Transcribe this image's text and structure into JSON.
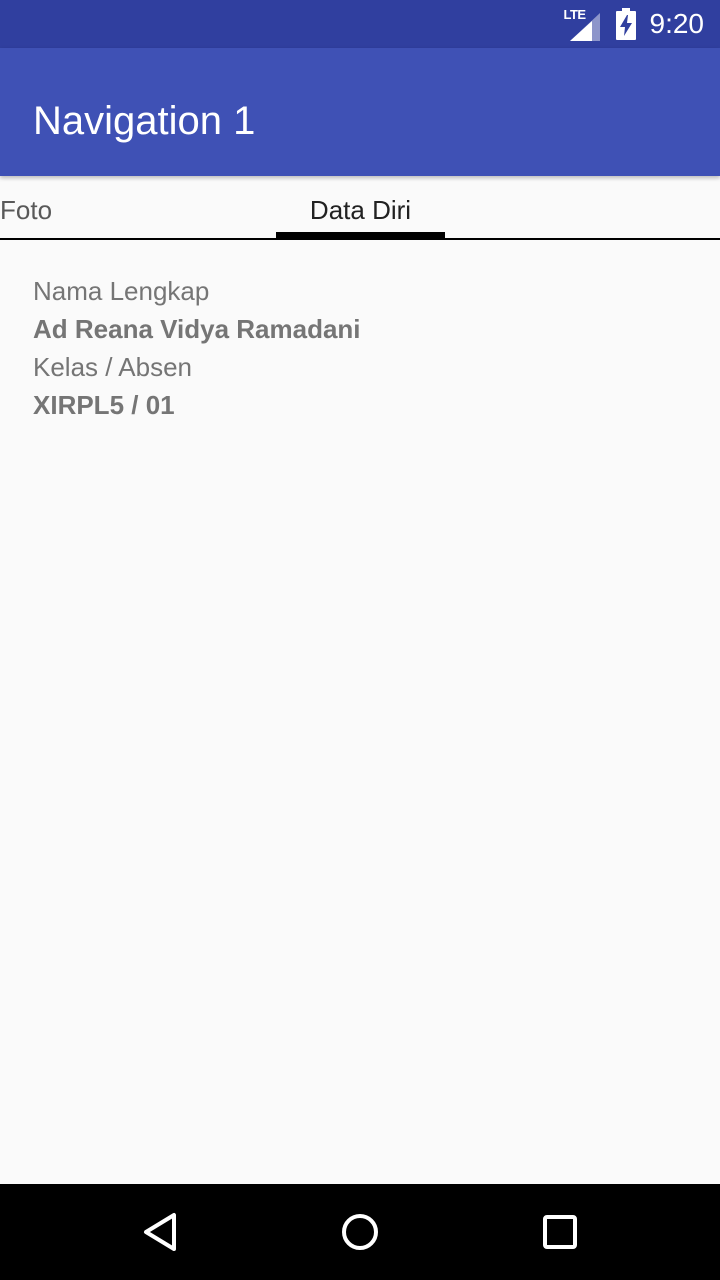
{
  "status_bar": {
    "network_label": "LTE",
    "time": "9:20",
    "icons": [
      "lte-signal-icon",
      "battery-charging-icon"
    ]
  },
  "app_bar": {
    "title": "Navigation 1"
  },
  "tabs": [
    {
      "label": "Foto",
      "selected": false
    },
    {
      "label": "Data Diri",
      "selected": true
    }
  ],
  "profile": {
    "name_label": "Nama Lengkap",
    "name_value": "Ad Reana Vidya Ramadani",
    "class_label": "Kelas / Absen",
    "class_value": "XIRPL5 / 01"
  },
  "nav_bar": {
    "icons": [
      "back-icon",
      "home-icon",
      "recents-icon"
    ]
  },
  "colors": {
    "status_bar": "#303f9f",
    "app_bar": "#3f51b5",
    "background": "#fafafa",
    "text_secondary": "#757575",
    "tab_indicator": "#000000"
  }
}
